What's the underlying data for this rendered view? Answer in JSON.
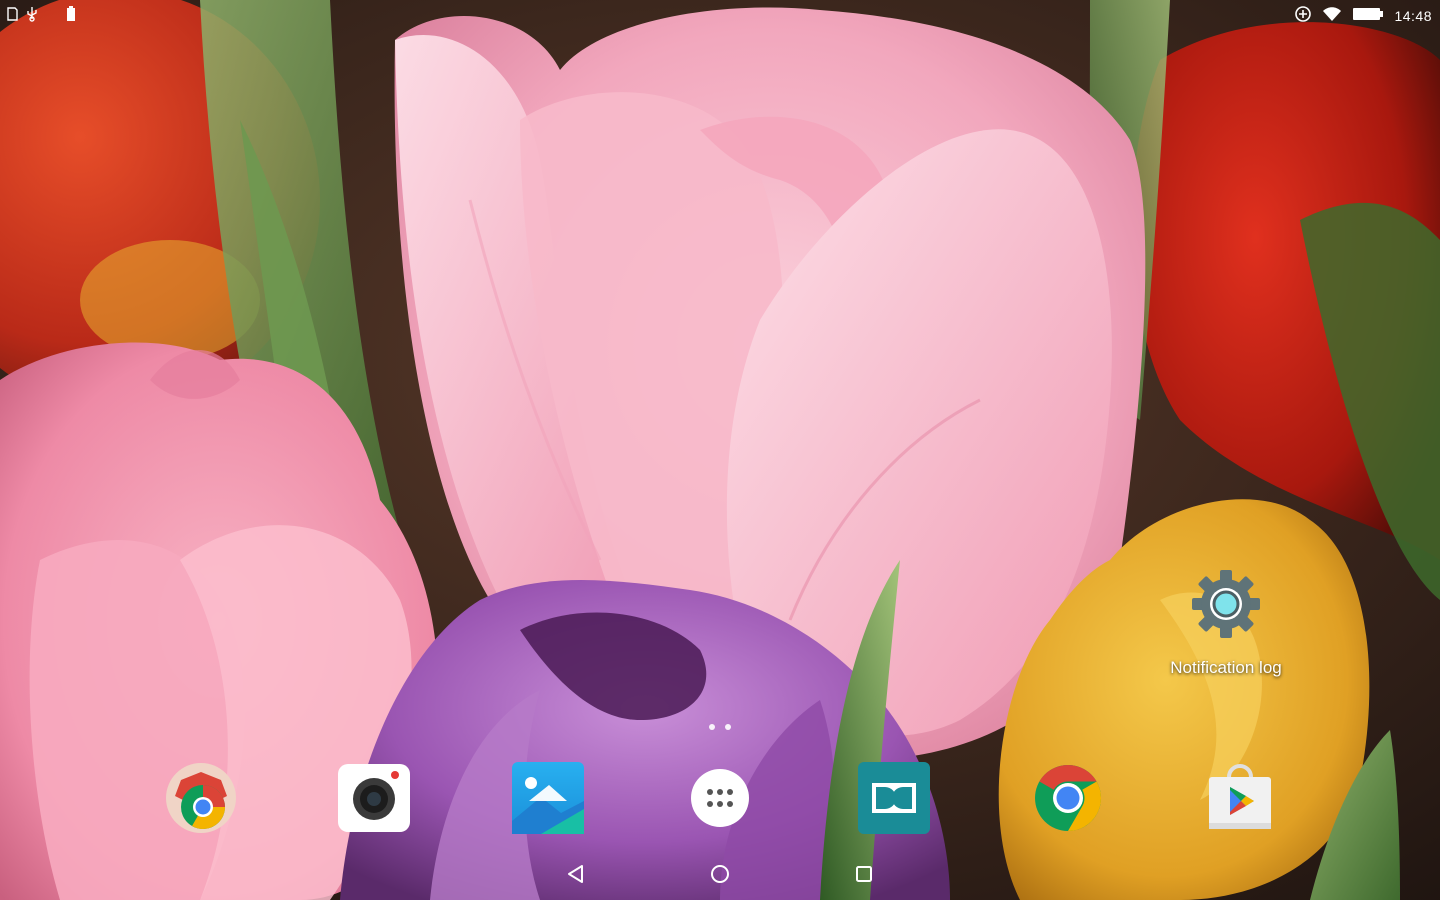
{
  "status_bar": {
    "time": "14:48",
    "left_icons": [
      "sd-card-icon",
      "usb-icon",
      "battery-saver-icon"
    ],
    "right_icons": [
      "data-saver-icon",
      "wifi-icon",
      "battery-icon"
    ]
  },
  "desktop": {
    "shortcuts": [
      {
        "label": "Notification log",
        "icon": "settings-gear-icon"
      }
    ],
    "page_indicator": {
      "pages": 2
    }
  },
  "dock": {
    "apps": [
      {
        "name": "Chrome Beta",
        "icon": "chrome-beta-icon"
      },
      {
        "name": "Camera",
        "icon": "camera-icon"
      },
      {
        "name": "Gallery",
        "icon": "gallery-icon"
      },
      {
        "name": "All apps",
        "icon": "app-drawer-icon"
      },
      {
        "name": "Dolby",
        "icon": "dolby-icon"
      },
      {
        "name": "Chrome",
        "icon": "chrome-icon"
      },
      {
        "name": "Play Store",
        "icon": "play-store-icon"
      }
    ]
  },
  "navigation_bar": {
    "buttons": [
      "back-icon",
      "home-icon",
      "recents-icon"
    ]
  },
  "colors": {
    "chrome_red": "#DB4437",
    "chrome_yellow": "#F4B400",
    "chrome_green": "#0F9D58",
    "chrome_blue": "#4285F4",
    "dolby_teal": "#1A8C97",
    "gallery_blue": "#1EA2E8",
    "settings_gray": "#5F7378",
    "settings_cyan": "#7FE3EB"
  }
}
